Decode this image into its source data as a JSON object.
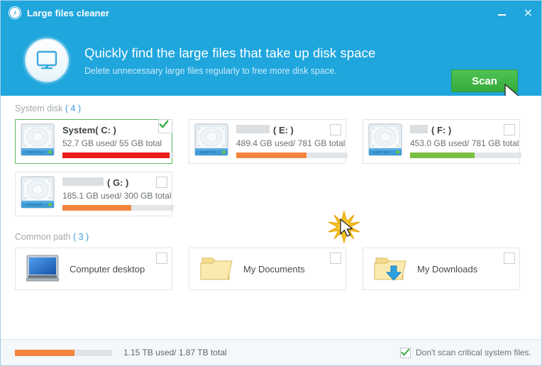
{
  "window": {
    "title": "Large files cleaner",
    "app_icon": "broom-circle-icon",
    "minimize_label": "",
    "close_label": "×"
  },
  "banner": {
    "icon": "monitor-icon",
    "title": "Quickly find the large files that take up disk space",
    "subtitle": "Delete unnecessary large files regularly to free more disk space.",
    "scan_label": "Scan",
    "accent_color": "#1fa6dd",
    "scan_color": "#3cb443"
  },
  "system_disk": {
    "label": "System disk",
    "count": "( 4 )",
    "drives": [
      {
        "name": "System",
        "letter": "( C: )",
        "redacted": false,
        "redact_width": 0,
        "used": "52.7 GB",
        "used_word": "used/",
        "total": "55 GB",
        "total_word": "total",
        "percent": 96,
        "bar_color": "#e81c19",
        "selected": true,
        "checked": true
      },
      {
        "name": "",
        "letter": "( E: )",
        "redacted": true,
        "redact_width": 47,
        "used": "489.4 GB",
        "used_word": "used/",
        "total": "781 GB",
        "total_word": "total",
        "percent": 63,
        "bar_color": "#f3853f",
        "selected": false,
        "checked": false
      },
      {
        "name": "",
        "letter": "( F: )",
        "redacted": true,
        "redact_width": 25,
        "used": "453.0 GB",
        "used_word": "used/",
        "total": "781 GB",
        "total_word": "total",
        "percent": 58,
        "bar_color": "#7ac143",
        "selected": false,
        "checked": false
      },
      {
        "name": "",
        "letter": "( G: )",
        "redacted": true,
        "redact_width": 58,
        "used": "185.1 GB",
        "used_word": "used/",
        "total": "300 GB",
        "total_word": "total",
        "percent": 62,
        "bar_color": "#f3853f",
        "selected": false,
        "checked": false
      }
    ]
  },
  "common_path": {
    "label": "Common path",
    "count": "( 3 )",
    "paths": [
      {
        "label": "Computer desktop",
        "icon": "monitor-desktop-icon",
        "checked": false
      },
      {
        "label": "My Documents",
        "icon": "folder-documents-icon",
        "checked": false
      },
      {
        "label": "My Downloads",
        "icon": "folder-download-icon",
        "checked": false
      }
    ]
  },
  "statusbar": {
    "total_percent": 61,
    "total_text": "1.15 TB  used/  1.87 TB  total",
    "option_label": "Don't scan critical system files.",
    "option_checked": true,
    "bar_color": "#f3853f"
  }
}
